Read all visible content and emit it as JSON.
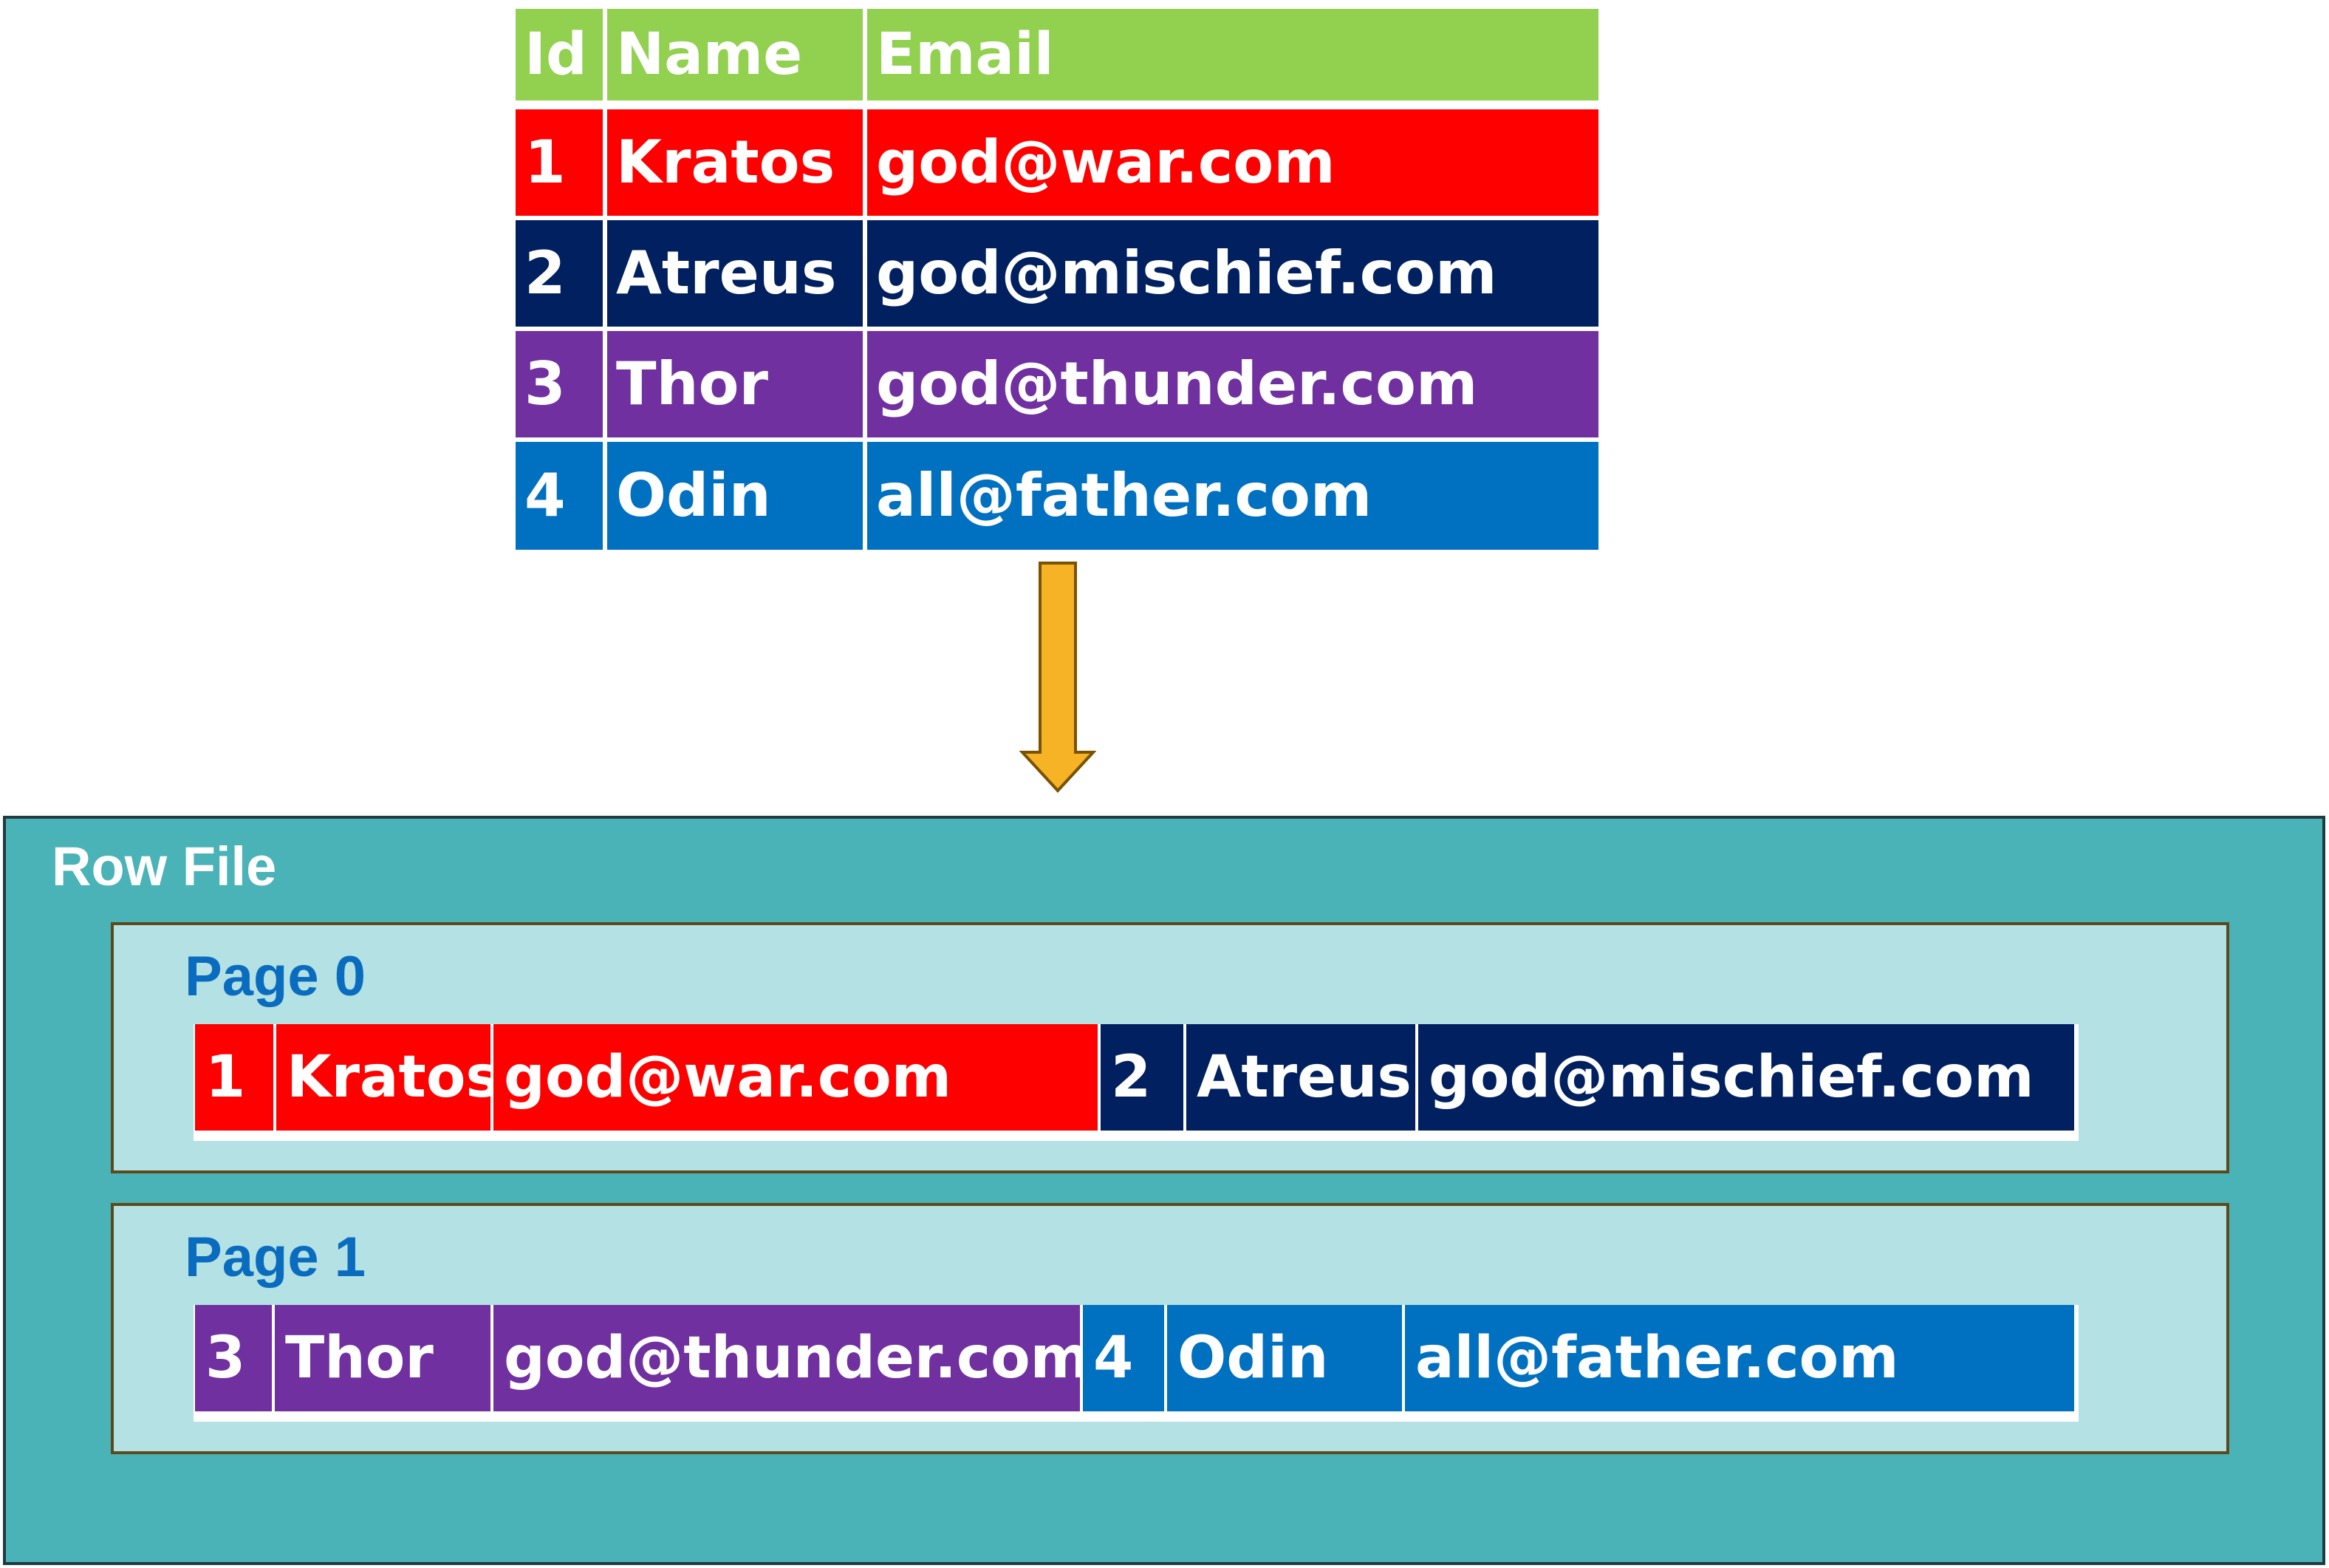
{
  "table": {
    "headers": [
      "Id",
      "Name",
      "Email"
    ],
    "header_color": "#92d050",
    "rows": [
      {
        "id": "1",
        "name": "Kratos",
        "email": "god@war.com",
        "color": "#ff0000"
      },
      {
        "id": "2",
        "name": "Atreus",
        "email": "god@mischief.com",
        "color": "#002060"
      },
      {
        "id": "3",
        "name": "Thor",
        "email": "god@thunder.com",
        "color": "#7030a0"
      },
      {
        "id": "4",
        "name": "Odin",
        "email": "all@father.com",
        "color": "#0070c0"
      }
    ]
  },
  "arrow": {
    "icon": "down-arrow-icon",
    "color": "#f5b325"
  },
  "row_file": {
    "title": "Row File",
    "pages": [
      {
        "title": "Page 0"
      },
      {
        "title": "Page 1"
      }
    ]
  }
}
